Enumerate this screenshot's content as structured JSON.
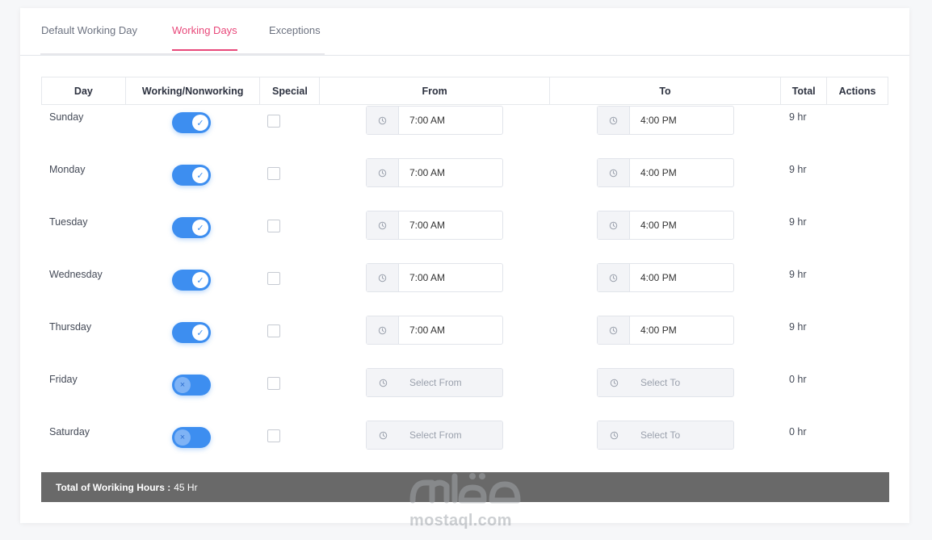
{
  "tabs": [
    {
      "label": "Default Working Day",
      "active": false
    },
    {
      "label": "Working Days",
      "active": true
    },
    {
      "label": "Exceptions",
      "active": false
    }
  ],
  "table": {
    "headers": [
      "Day",
      "Working/Nonworking",
      "Special",
      "From",
      "To",
      "Total",
      "Actions"
    ],
    "rows": [
      {
        "day": "Sunday",
        "working": true,
        "special": false,
        "from": "7:00 AM",
        "to": "4:00 PM",
        "total": "9 hr"
      },
      {
        "day": "Monday",
        "working": true,
        "special": false,
        "from": "7:00 AM",
        "to": "4:00 PM",
        "total": "9 hr"
      },
      {
        "day": "Tuesday",
        "working": true,
        "special": false,
        "from": "7:00 AM",
        "to": "4:00 PM",
        "total": "9 hr"
      },
      {
        "day": "Wednesday",
        "working": true,
        "special": false,
        "from": "7:00 AM",
        "to": "4:00 PM",
        "total": "9 hr"
      },
      {
        "day": "Thursday",
        "working": true,
        "special": false,
        "from": "7:00 AM",
        "to": "4:00 PM",
        "total": "9 hr"
      },
      {
        "day": "Friday",
        "working": false,
        "special": false,
        "from": "",
        "to": "",
        "total": "0 hr"
      },
      {
        "day": "Saturday",
        "working": false,
        "special": false,
        "from": "",
        "to": "",
        "total": "0 hr"
      }
    ],
    "from_placeholder": "Select From",
    "to_placeholder": "Select To"
  },
  "footer": {
    "label": "Total of Woriking Hours :",
    "value": "45 Hr"
  },
  "watermark": {
    "text": "mostaql.com",
    "arabic_logo": "مستقل"
  },
  "colors": {
    "accent": "#e8487a",
    "toggle": "#3d8ef0",
    "footer_bg": "#696969"
  },
  "icons": {
    "toggle_on": "check-icon",
    "toggle_off": "x-icon",
    "time": "clock-icon"
  }
}
